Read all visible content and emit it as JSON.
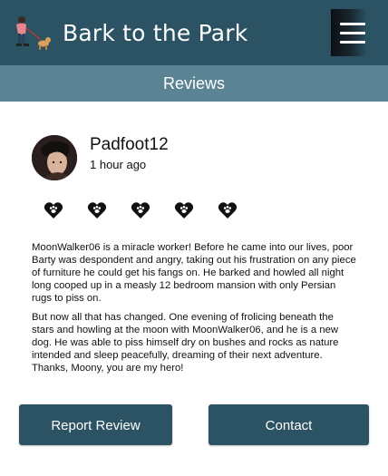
{
  "app": {
    "title": "Bark to the Park",
    "logo_icon": "dog-walker-icon",
    "menu_icon": "hamburger-menu-icon"
  },
  "page": {
    "section_title": "Reviews"
  },
  "review": {
    "reviewer_name": "Padfoot12",
    "timestamp": "1 hour ago",
    "rating": 5,
    "rating_max": 5,
    "rating_icon": "paw-heart-icon",
    "paragraphs": [
      "MoonWalker06 is a miracle worker! Before he came into our lives, poor Barty was despondent and angry, taking out his frustration on any piece of furniture he could get his fangs on. He barked and howled all night long cooped up in a measly 12 bedroom mansion with only Persian rugs to piss on.",
      "But now all that has changed. One evening of frolicing beneath the stars and howling at the moon with MoonWalker06, and he is a new dog. He was able to piss himself dry on bushes and rocks as nature intended and sleep peacefully, dreaming of their next adventure. Thanks, Moony, you are my hero!"
    ]
  },
  "actions": {
    "report_label": "Report Review",
    "contact_label": "Contact"
  },
  "colors": {
    "primary": "#2c5364",
    "subheader": "#5a8494",
    "text": "#111111",
    "background": "#ffffff"
  }
}
